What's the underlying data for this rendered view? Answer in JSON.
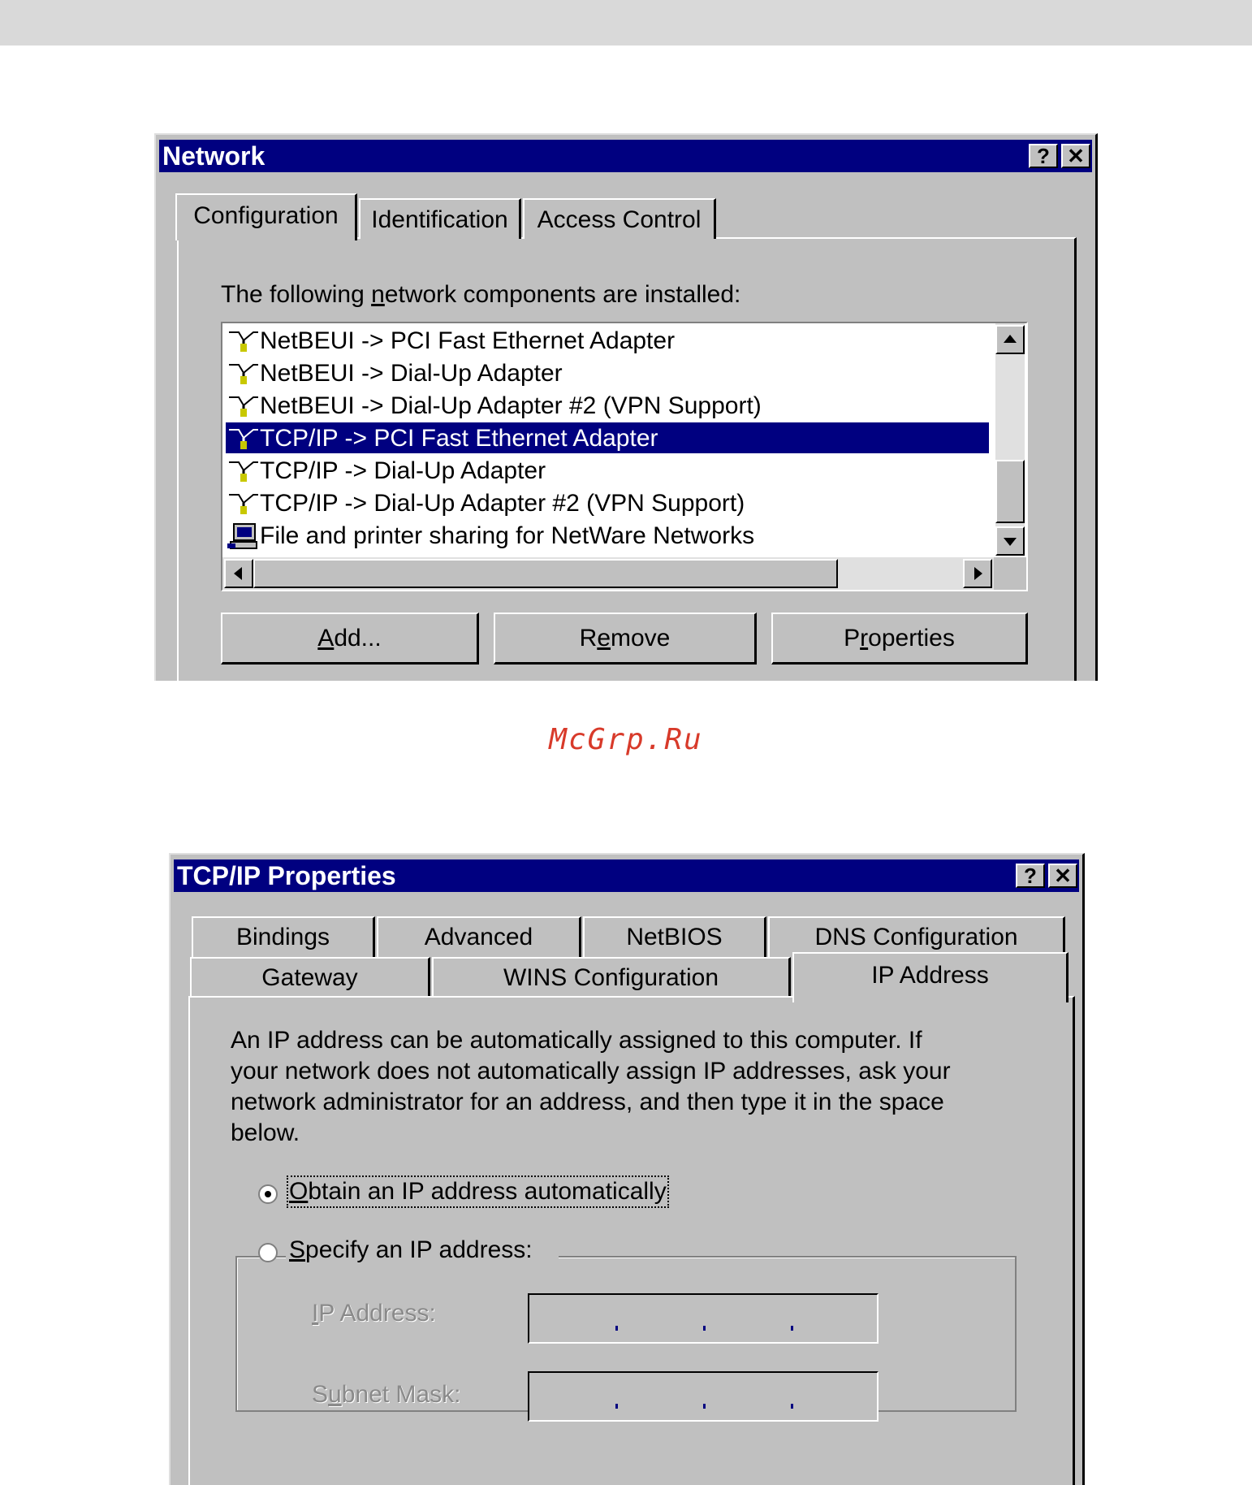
{
  "network_dialog": {
    "title": "Network",
    "help_glyph": "?",
    "close_glyph": "✕",
    "tabs": [
      {
        "label": "Configuration",
        "active": true
      },
      {
        "label": "Identification",
        "active": false
      },
      {
        "label": "Access Control",
        "active": false
      }
    ],
    "components_label_pre": "The following ",
    "components_label_key": "n",
    "components_label_post": "etwork components are installed:",
    "components": [
      {
        "label": "NetBEUI -> PCI Fast Ethernet Adapter",
        "icon": "protocol-icon",
        "selected": false
      },
      {
        "label": "NetBEUI -> Dial-Up Adapter",
        "icon": "protocol-icon",
        "selected": false
      },
      {
        "label": "NetBEUI -> Dial-Up Adapter #2 (VPN Support)",
        "icon": "protocol-icon",
        "selected": false
      },
      {
        "label": "TCP/IP -> PCI Fast Ethernet Adapter",
        "icon": "protocol-icon",
        "selected": true
      },
      {
        "label": "TCP/IP -> Dial-Up Adapter",
        "icon": "protocol-icon",
        "selected": false
      },
      {
        "label": "TCP/IP -> Dial-Up Adapter #2 (VPN Support)",
        "icon": "protocol-icon",
        "selected": false
      },
      {
        "label": "File and printer sharing for NetWare Networks",
        "icon": "file-sharing-service-icon",
        "selected": false
      }
    ],
    "buttons": {
      "add_key": "A",
      "add_rest": "dd...",
      "remove_pre": "R",
      "remove_key": "e",
      "remove_rest": "move",
      "properties_pre": "P",
      "properties_key": "r",
      "properties_rest": "operties"
    }
  },
  "watermark": "McGrp.Ru",
  "tcpip_dialog": {
    "title": "TCP/IP Properties",
    "help_glyph": "?",
    "close_glyph": "✕",
    "tabs_row1": [
      "Bindings",
      "Advanced",
      "NetBIOS",
      "DNS Configuration"
    ],
    "tabs_row2": [
      "Gateway",
      "WINS Configuration"
    ],
    "active_tab": "IP Address",
    "description_lines": [
      "An IP address can be automatically assigned to this computer.  If",
      "your network does not automatically assign IP addresses, ask your",
      "network administrator for an address, and then type it in the space",
      "below."
    ],
    "obtain_key": "O",
    "obtain_rest": "btain an IP address automatically",
    "specify_key": "S",
    "specify_rest": "pecify an IP address:",
    "ip_label_key": "I",
    "ip_label_rest": "P Address:",
    "subnet_pre": "S",
    "subnet_key": "u",
    "subnet_rest": "bnet Mask:",
    "ip_address_value": "",
    "subnet_mask_value": ""
  },
  "colors": {
    "titlebar": "#000080",
    "face": "#c0c0c0",
    "selection": "#000080",
    "watermark": "#d83a2a"
  }
}
